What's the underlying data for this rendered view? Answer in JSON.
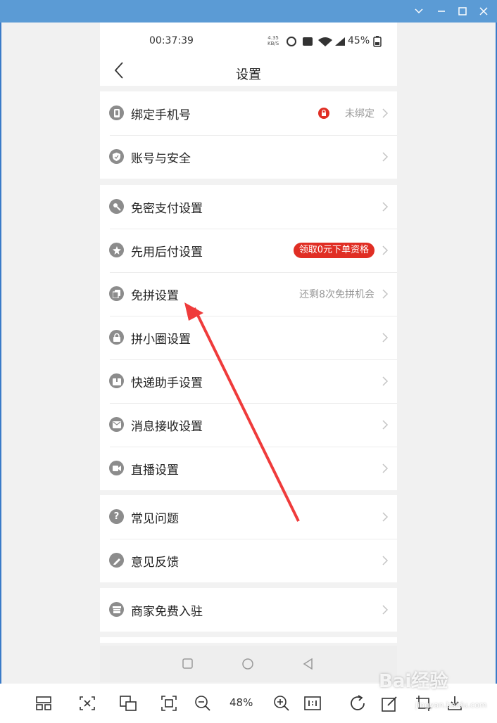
{
  "window": {
    "minimize": "—",
    "maximize": "☐",
    "close": "✕"
  },
  "status": {
    "time": "00:37:39",
    "speed_top": "4.35",
    "speed_bottom": "KB/S",
    "battery": "45%"
  },
  "nav": {
    "title": "设置"
  },
  "groups": {
    "g1": [
      {
        "label": "绑定手机号",
        "value": "未绑定"
      },
      {
        "label": "账号与安全"
      }
    ],
    "g2": [
      {
        "label": "免密支付设置"
      },
      {
        "label": "先用后付设置",
        "badge": "领取0元下单资格"
      },
      {
        "label": "免拼设置",
        "value": "还剩8次免拼机会"
      },
      {
        "label": "拼小圈设置"
      },
      {
        "label": "快递助手设置"
      },
      {
        "label": "消息接收设置"
      },
      {
        "label": "直播设置"
      }
    ],
    "g3": [
      {
        "label": "常见问题"
      },
      {
        "label": "意见反馈"
      }
    ],
    "g4": [
      {
        "label": "商家免费入驻"
      }
    ]
  },
  "toolbar": {
    "zoom": "48%"
  },
  "icons": [
    "layout-icon",
    "fit-icon",
    "original-size-icon",
    "fullscreen-icon",
    "zoom-out-icon",
    "zoom-in-icon",
    "one-to-one-icon",
    "rotate-icon",
    "edit-icon",
    "crop-icon",
    "download-icon"
  ],
  "watermark": {
    "brand": "Bai经验",
    "url": "jingyan.baidu.com"
  },
  "colors": {
    "titlebar": "#5b9bd5",
    "accent": "#e02e24",
    "arrow": "#ef3b3b"
  }
}
